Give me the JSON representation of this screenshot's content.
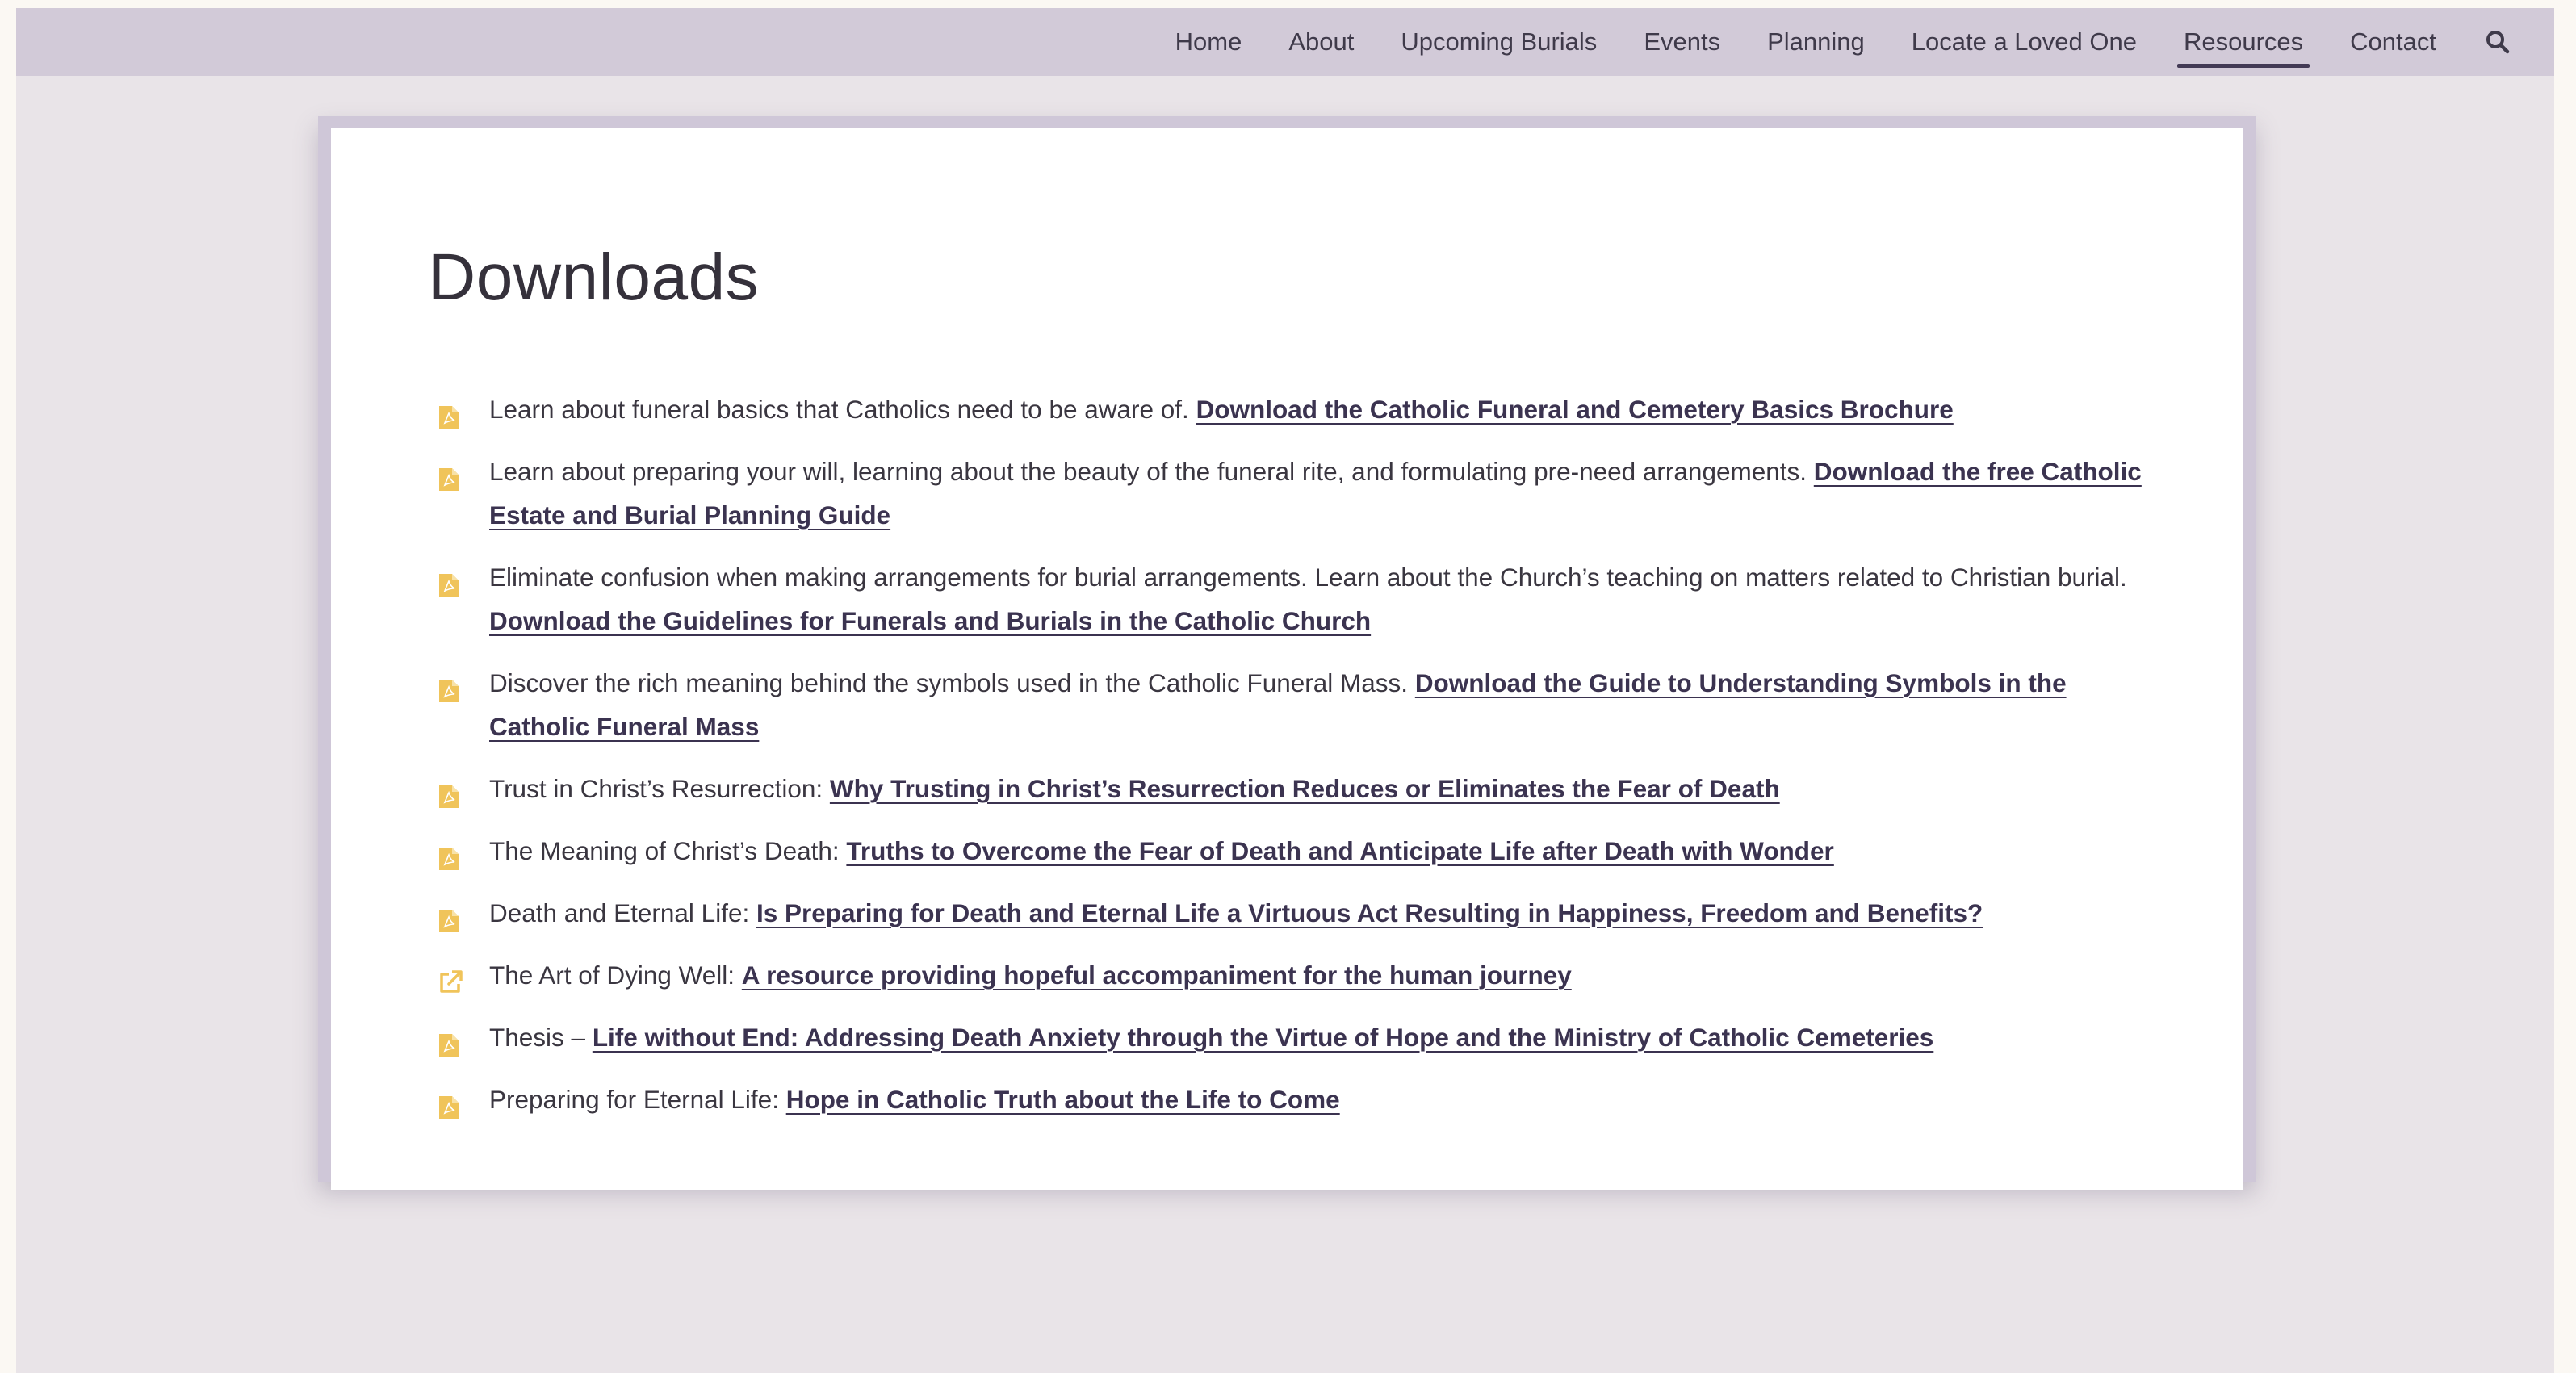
{
  "nav": {
    "items": [
      "Home",
      "About",
      "Upcoming Burials",
      "Events",
      "Planning",
      "Locate a Loved One",
      "Resources",
      "Contact"
    ],
    "active": "Resources",
    "search_icon": "search-icon"
  },
  "main": {
    "title": "Downloads",
    "items": [
      {
        "icon": "pdf-file-icon",
        "text": "Learn about funeral basics that Catholics need to be aware of. ",
        "link": "Download the Catholic Funeral and Cemetery Basics Brochure"
      },
      {
        "icon": "pdf-file-icon",
        "text": "Learn about preparing your will, learning about the beauty of the funeral rite, and formulating pre-need arrangements. ",
        "link": "Download the free Catholic Estate and Burial Planning Guide"
      },
      {
        "icon": "pdf-file-icon",
        "text": "Eliminate confusion when making arrangements for burial arrangements. Learn about the Church’s teaching on matters related to Christian burial. ",
        "link": "Download the Guidelines for Funerals and Burials in the Catholic Church"
      },
      {
        "icon": "pdf-file-icon",
        "text": "Discover the rich meaning behind the symbols used in the Catholic Funeral Mass. ",
        "link": "Download the Guide to Understanding Symbols in the Catholic Funeral Mass"
      },
      {
        "icon": "pdf-file-icon",
        "text": "Trust in Christ’s Resurrection: ",
        "link": "Why Trusting in Christ’s Resurrection Reduces or Eliminates the Fear of Death"
      },
      {
        "icon": "pdf-file-icon",
        "text": "The Meaning of Christ’s Death: ",
        "link": "Truths to Overcome the Fear of Death and Anticipate Life after Death with Wonder"
      },
      {
        "icon": "pdf-file-icon",
        "text": "Death and Eternal Life: ",
        "link": "Is Preparing for Death and Eternal Life a Virtuous Act Resulting in Happiness, Freedom and Benefits?"
      },
      {
        "icon": "external-link-icon",
        "text": "The Art of Dying Well: ",
        "link": "A resource providing hopeful accompaniment for the human journey"
      },
      {
        "icon": "pdf-file-icon",
        "text": "Thesis – ",
        "link": "Life without End: Addressing Death Anxiety through the Virtue of Hope and the Ministry of Catholic Cemeteries"
      },
      {
        "icon": "pdf-file-icon",
        "text": "Preparing for Eternal Life: ",
        "link": "Hope in Catholic Truth about the Life to Come"
      }
    ]
  },
  "colors": {
    "nav_bg": "#d2cad8",
    "page_bg": "#e9e4e8",
    "icon_accent": "#f0c45a",
    "link": "#3b3350"
  }
}
